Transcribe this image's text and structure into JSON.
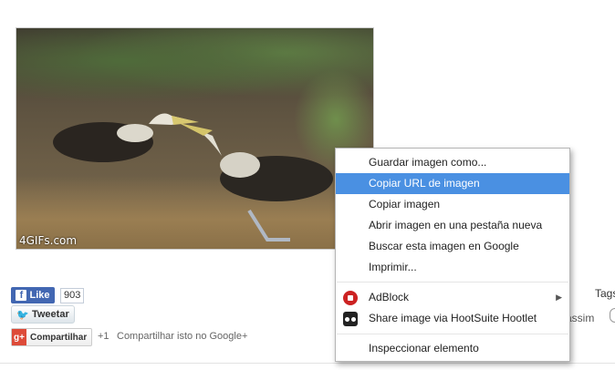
{
  "image": {
    "watermark": "4GIFs.com"
  },
  "social": {
    "like_label": "Like",
    "like_count": "903",
    "tweet_label": "Tweetar",
    "gplus_label": "Compartilhar",
    "gplus_count": "+1",
    "gplus_text": "Compartilhar isto no Google+"
  },
  "page": {
    "tags_label": "Tags",
    "assim_text": "assim"
  },
  "context_menu": {
    "items": [
      {
        "label": "Guardar imagen como..."
      },
      {
        "label": "Copiar URL de imagen"
      },
      {
        "label": "Copiar imagen"
      },
      {
        "label": "Abrir imagen en una pestaña nueva"
      },
      {
        "label": "Buscar esta imagen en Google"
      },
      {
        "label": "Imprimir..."
      },
      {
        "label": "AdBlock"
      },
      {
        "label": "Share image via HootSuite Hootlet"
      },
      {
        "label": "Inspeccionar elemento"
      }
    ],
    "highlighted_index": 1,
    "highlight_color": "#4a90e2"
  }
}
